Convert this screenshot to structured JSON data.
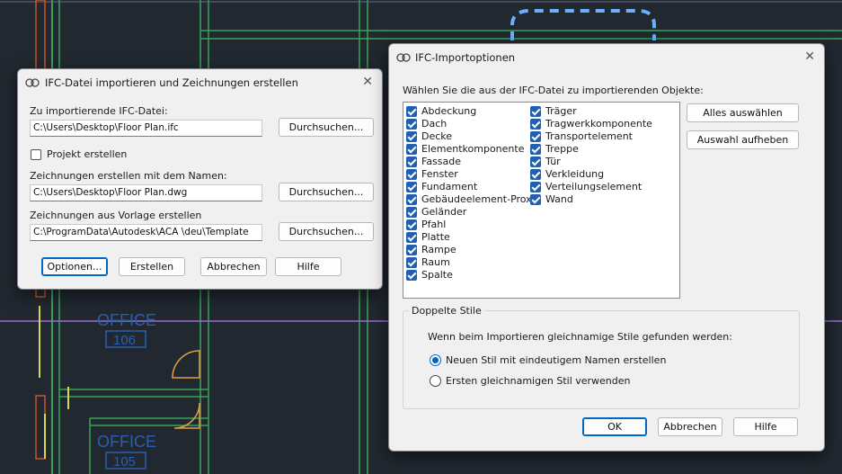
{
  "background": {
    "room_labels": [
      {
        "name": "OFFICE",
        "number": "106"
      },
      {
        "name": "OFFICE",
        "number": "105"
      }
    ]
  },
  "import_dialog": {
    "title": "IFC-Datei importieren und Zeichnungen erstellen",
    "ifc_file_label": "Zu importierende IFC-Datei:",
    "ifc_file_value": "C:\\Users\\Desktop\\Floor Plan.ifc",
    "browse_label": "Durchsuchen...",
    "create_project_label": "Projekt erstellen",
    "create_project_checked": false,
    "drawing_name_label": "Zeichnungen erstellen mit dem Namen:",
    "drawing_name_value": "C:\\Users\\Desktop\\Floor Plan.dwg",
    "template_label": "Zeichnungen aus Vorlage erstellen",
    "template_value": "C:\\ProgramData\\Autodesk\\ACA \\deu\\Template",
    "buttons": {
      "options": "Optionen...",
      "create": "Erstellen",
      "cancel": "Abbrechen",
      "help": "Hilfe"
    }
  },
  "options_dialog": {
    "title": "IFC-Importoptionen",
    "instruction": "Wählen Sie die aus der IFC-Datei zu importierenden Objekte:",
    "objects_col1": [
      "Abdeckung",
      "Dach",
      "Decke",
      "Elementkomponente",
      "Fassade",
      "Fenster",
      "Fundament",
      "Gebäudeelement-Proxy",
      "Geländer",
      "Pfahl",
      "Platte",
      "Rampe",
      "Raum",
      "Spalte"
    ],
    "objects_col2": [
      "Träger",
      "Tragwerkkomponente",
      "Transportelement",
      "Treppe",
      "Tür",
      "Verkleidung",
      "Verteilungselement",
      "Wand"
    ],
    "select_all": "Alles auswählen",
    "deselect": "Auswahl aufheben",
    "dup_group_title": "Doppelte Stile",
    "dup_question": "Wenn beim Importieren gleichnamige Stile gefunden werden:",
    "radio_new": "Neuen Stil mit eindeutigem Namen erstellen",
    "radio_first": "Ersten gleichnamigen Stil verwenden",
    "selected_radio": "new",
    "buttons": {
      "ok": "OK",
      "cancel": "Abbrechen",
      "help": "Hilfe"
    }
  },
  "colors": {
    "cad_background": "#212830",
    "wall_lines": "#3aa35a",
    "grid_lines": "#9a6fc9",
    "room_label": "#2a5fb0",
    "checkbox_accent": "#1f5fb4"
  }
}
